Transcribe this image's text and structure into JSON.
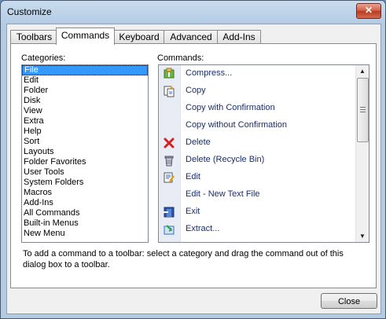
{
  "window": {
    "title": "Customize"
  },
  "tabs": [
    {
      "label": "Toolbars"
    },
    {
      "label": "Commands",
      "active": true
    },
    {
      "label": "Keyboard"
    },
    {
      "label": "Advanced"
    },
    {
      "label": "Add-Ins"
    }
  ],
  "categories": {
    "label": "Categories:",
    "selected": "File",
    "items": [
      "File",
      "Edit",
      "Folder",
      "Disk",
      "View",
      "Extra",
      "Help",
      "Sort",
      "Layouts",
      "Folder Favorites",
      "User Tools",
      "System Folders",
      "Macros",
      "Add-Ins",
      "All Commands",
      "Built-in Menus",
      "New Menu"
    ]
  },
  "commands": {
    "label": "Commands:",
    "items": [
      {
        "label": "Compress...",
        "icon": "compress-icon"
      },
      {
        "label": "Copy",
        "icon": "copy-icon"
      },
      {
        "label": "Copy with Confirmation",
        "icon": ""
      },
      {
        "label": "Copy without Confirmation",
        "icon": ""
      },
      {
        "label": "Delete",
        "icon": "delete-x-icon"
      },
      {
        "label": "Delete (Recycle Bin)",
        "icon": "recycle-bin-icon"
      },
      {
        "label": "Edit",
        "icon": "edit-icon"
      },
      {
        "label": "Edit - New Text File",
        "icon": ""
      },
      {
        "label": "Exit",
        "icon": "exit-icon"
      },
      {
        "label": "Extract...",
        "icon": "extract-icon"
      }
    ]
  },
  "hint": "To add a command to a toolbar: select a category and drag the command out of this dialog box to a toolbar.",
  "buttons": {
    "close": "Close",
    "title_close": "✕"
  },
  "colors": {
    "selection": "#3399ff",
    "command_text": "#1b2e6b"
  }
}
